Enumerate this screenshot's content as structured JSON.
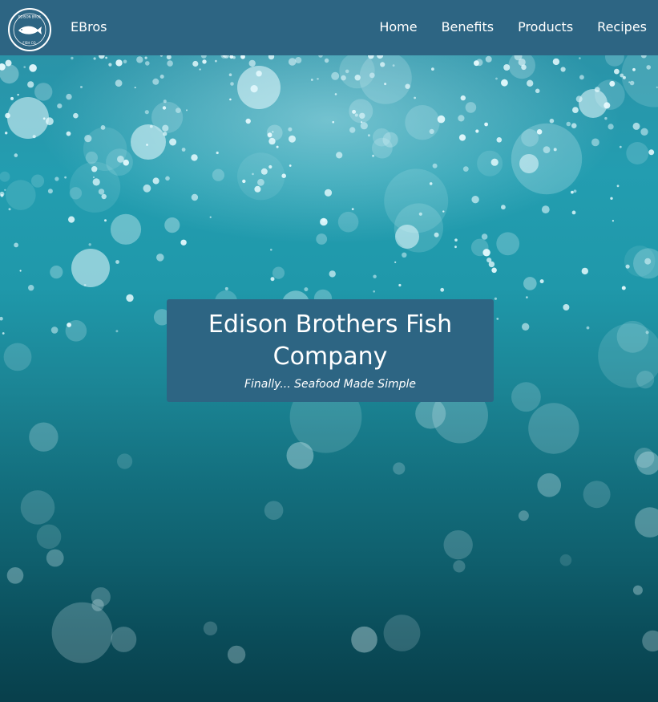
{
  "nav": {
    "logo_icon": "edison-bros-fish-co-logo",
    "logo_text_top": "EDISON BROS",
    "logo_text_bottom": "FISH CO.",
    "brand": "EBros",
    "links": [
      {
        "label": "Home"
      },
      {
        "label": "Benefits"
      },
      {
        "label": "Products"
      },
      {
        "label": "Recipes"
      }
    ]
  },
  "hero": {
    "background": "underwater-bubbles-photo",
    "title": "Edison Brothers Fish Company",
    "tagline": "Finally... Seafood Made Simple"
  },
  "colors": {
    "navbar": "#2d6583",
    "card": "#2d6583",
    "text": "#ffffff",
    "water_light": "#239db0",
    "water_dark": "#083f4b"
  }
}
